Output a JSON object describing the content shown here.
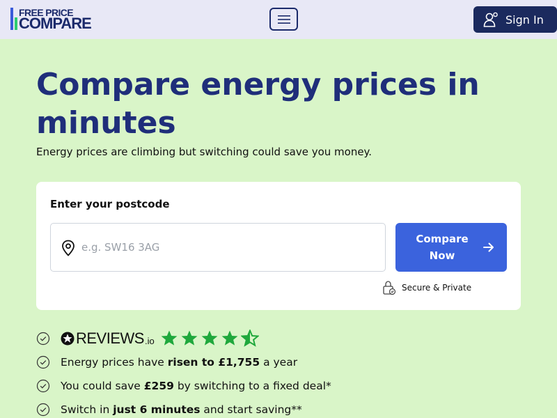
{
  "header": {
    "logo_top": "FREE PRICE",
    "logo_bottom": "COMPARE",
    "menu_icon": "hamburger-icon",
    "signin_label": "Sign In",
    "signin_icon": "user-icon"
  },
  "hero": {
    "title": "Compare energy prices in minutes",
    "subtitle": "Energy prices are climbing but switching could save you money."
  },
  "form": {
    "label": "Enter your postcode",
    "placeholder": "e.g. SW16 3AG",
    "value": "",
    "button_label": "Compare Now",
    "secure_label": "Secure & Private"
  },
  "reviews": {
    "brand": "REVIEWS",
    "brand_suffix": ".io",
    "rating": 4.5,
    "max_rating": 5
  },
  "bullets": [
    {
      "pre": "Energy prices have ",
      "bold": "risen to £1,755",
      "post": " a year"
    },
    {
      "pre": "You could save ",
      "bold": "£259",
      "post": " by switching to a fixed deal*"
    },
    {
      "pre": "Switch in ",
      "bold": "just 6 minutes",
      "post": " and start saving**"
    }
  ],
  "colors": {
    "background": "#d9f5c8",
    "header_bg": "#e8e8f6",
    "brand_navy": "#1f2e7a",
    "button_blue": "#3b63dd",
    "star_green": "#1fa83c"
  }
}
